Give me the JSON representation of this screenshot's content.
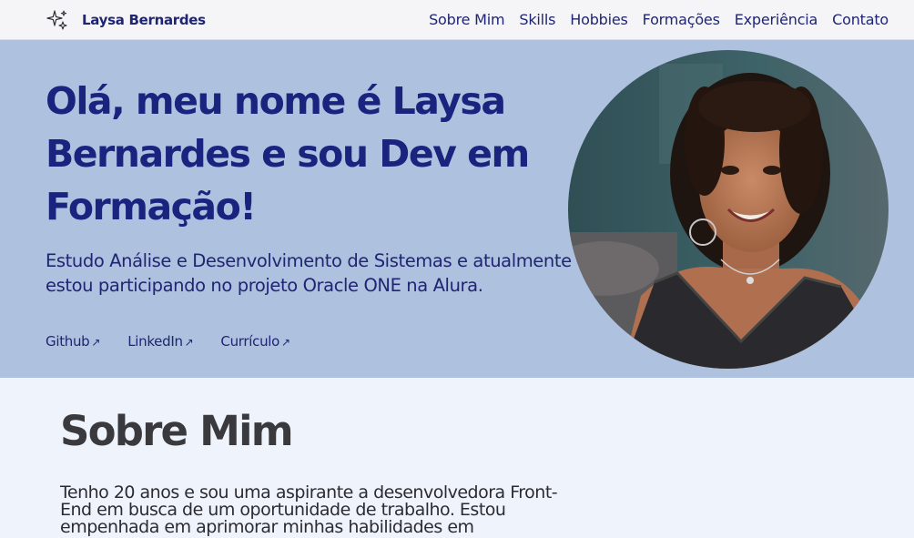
{
  "nav": {
    "brand": "Laysa Bernardes",
    "brand_icon": "sparkles-icon",
    "links": [
      "Sobre Mim",
      "Skills",
      "Hobbies",
      "Formações",
      "Experiência",
      "Contato"
    ]
  },
  "hero": {
    "title": "Olá, meu nome é Laysa Bernardes e sou Dev em Formação!",
    "description": "Estudo Análise e Desenvolvimento de Sistemas e atualmente estou participando no projeto Oracle ONE na Alura.",
    "links": [
      {
        "label": "Github",
        "icon": "arrow-up-right-icon"
      },
      {
        "label": "LinkedIn",
        "icon": "arrow-up-right-icon"
      },
      {
        "label": "Currículo",
        "icon": "arrow-up-right-icon"
      }
    ],
    "photo": "profile-photo"
  },
  "about": {
    "title": "Sobre Mim",
    "text": "Tenho 20 anos e sou uma aspirante a desenvolvedora Front-End em busca de um oportunidade de trabalho. Estou empenhada em aprimorar minhas habilidades em"
  },
  "colors": {
    "navbar_bg": "#f5f5f7",
    "hero_bg": "#aec1df",
    "accent": "#1a237e",
    "page_bg": "#eef3fc"
  }
}
